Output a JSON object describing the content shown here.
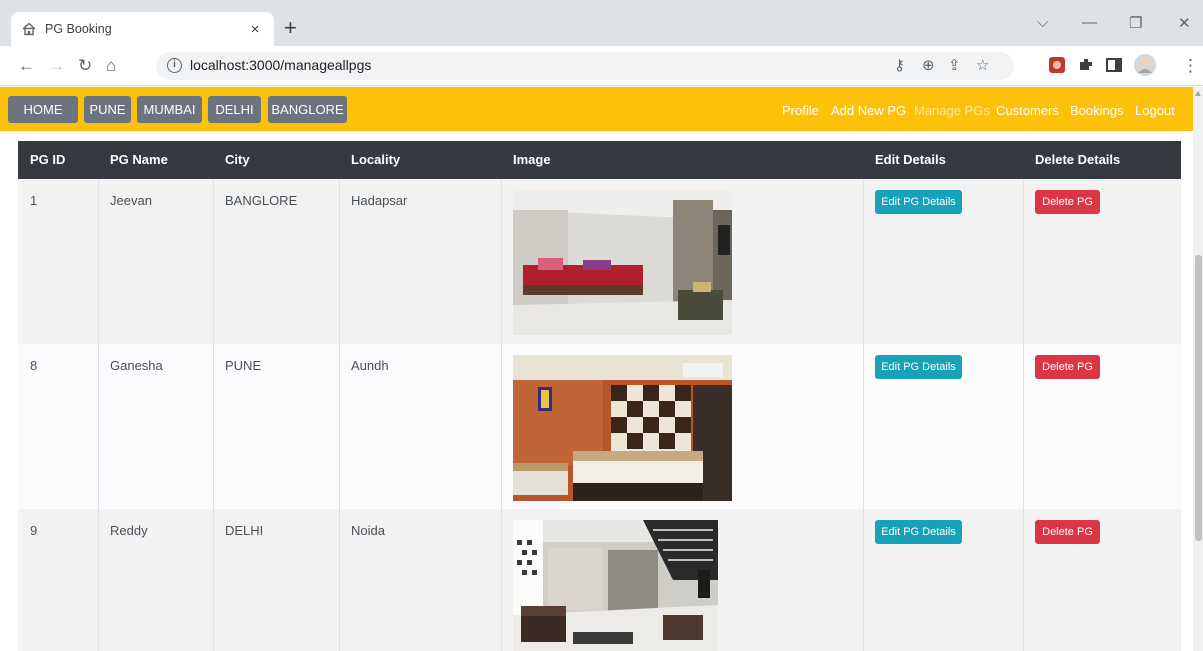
{
  "browser": {
    "tab_title": "PG Booking",
    "tab_close": "×",
    "new_tab": "+",
    "url": "localhost:3000/manageallpgs",
    "controls": {
      "dropdown": "⌵",
      "minimize": "—",
      "restore": "❐",
      "close": "✕"
    }
  },
  "navbar": {
    "city_buttons": [
      "HOME",
      "PUNE",
      "MUMBAI",
      "DELHI",
      "BANGLORE"
    ],
    "links": [
      "Profile",
      "Add New PG",
      "Manage PGs",
      "Customers",
      "Bookings",
      "Logout"
    ],
    "active_link": "Manage PGs"
  },
  "table": {
    "headers": [
      "PG ID",
      "PG Name",
      "City",
      "Locality",
      "Image",
      "Edit Details",
      "Delete Details"
    ],
    "edit_label": "Edit PG Details",
    "delete_label": "Delete PG",
    "rows": [
      {
        "id": "1",
        "name": "Jeevan",
        "city": "BANGLORE",
        "locality": "Hadapsar",
        "image": "pg-room-photo-1"
      },
      {
        "id": "8",
        "name": "Ganesha",
        "city": "PUNE",
        "locality": "Aundh",
        "image": "pg-room-photo-2"
      },
      {
        "id": "9",
        "name": "Reddy",
        "city": "DELHI",
        "locality": "Noida",
        "image": "pg-room-photo-3"
      }
    ]
  },
  "colors": {
    "navbar": "#fcc10a",
    "city_button": "#6c757d",
    "table_header": "#343a40",
    "edit_button": "#17a2b8",
    "delete_button": "#dc3545"
  }
}
